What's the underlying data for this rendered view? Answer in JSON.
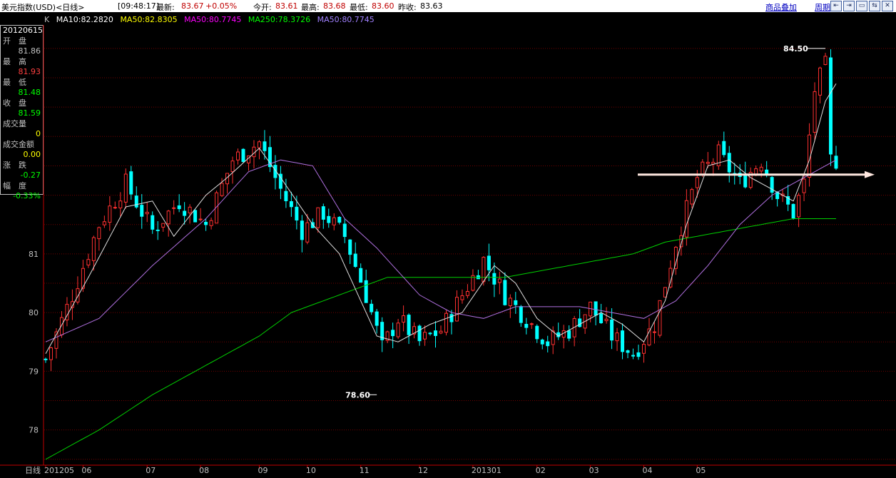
{
  "header": {
    "title": "美元指数(USD)<日线>",
    "time": "[09:48:17]",
    "latest_label": "最新:",
    "latest_value": "83.67",
    "change": "+0.05%",
    "open_label": "今开:",
    "open_value": "83.61",
    "high_label": "最高:",
    "high_value": "83.68",
    "low_label": "最低:",
    "low_value": "83.60",
    "prev_label": "昨收:",
    "prev_value": "83.63",
    "overlay_link": "商品叠加",
    "period_link": "周期"
  },
  "window_buttons": [
    "⇤",
    "⇥",
    "▭",
    "⇆",
    "✕"
  ],
  "ma_legend": {
    "k": "K",
    "items": [
      {
        "text": "MA10:82.2820",
        "color": "#ffffff"
      },
      {
        "text": "MA50:82.8305",
        "color": "#ffff00"
      },
      {
        "text": "MA50:80.7745",
        "color": "#ff00ff"
      },
      {
        "text": "MA250:78.3726",
        "color": "#00ff00"
      },
      {
        "text": "MA50:80.7745",
        "color": "#a080ff"
      }
    ]
  },
  "infobox": {
    "date": "20120615",
    "rows": [
      {
        "label": "开　盘",
        "value": "81.86",
        "color": "#c0c0c0"
      },
      {
        "label": "最　高",
        "value": "81.93",
        "color": "#ff4040"
      },
      {
        "label": "最　低",
        "value": "81.48",
        "color": "#00ff00"
      },
      {
        "label": "收　盘",
        "value": "81.59",
        "color": "#00ff00"
      },
      {
        "label": "成交量",
        "value": "0",
        "color": "#ffff00"
      },
      {
        "label": "成交金额",
        "value": "0.00",
        "color": "#ffff00"
      },
      {
        "label": "涨　跌",
        "value": "-0.27",
        "color": "#00ff00"
      },
      {
        "label": "幅　度",
        "value": "-0.33%",
        "color": "#00ff00"
      }
    ]
  },
  "chart_data": {
    "type": "candlestick",
    "ylim": [
      77.4,
      84.9
    ],
    "y_ticks": [
      "78",
      "79",
      "80",
      "81"
    ],
    "x_ticks": [
      "201205",
      "06",
      "07",
      "08",
      "09",
      "10",
      "11",
      "12",
      "201301",
      "02",
      "03",
      "04",
      "05"
    ],
    "x_axis_prefix": "日线",
    "annotations": [
      {
        "text": "84.50",
        "kind": "high"
      },
      {
        "text": "78.60",
        "kind": "low"
      }
    ],
    "up_color": "#ff3030",
    "down_color": "#00ffff",
    "close_path": [
      [
        0,
        79.2
      ],
      [
        5,
        80.3
      ],
      [
        10,
        81.5
      ],
      [
        15,
        82.2
      ],
      [
        20,
        81.4
      ],
      [
        25,
        81.9
      ],
      [
        30,
        81.5
      ],
      [
        35,
        82.6
      ],
      [
        40,
        82.9
      ],
      [
        44,
        82.1
      ],
      [
        48,
        81.4
      ],
      [
        52,
        81.7
      ],
      [
        56,
        81.3
      ],
      [
        60,
        80.3
      ],
      [
        63,
        79.4
      ],
      [
        66,
        79.9
      ],
      [
        70,
        79.5
      ],
      [
        74,
        79.7
      ],
      [
        78,
        80.3
      ],
      [
        82,
        80.9
      ],
      [
        86,
        80.3
      ],
      [
        90,
        79.9
      ],
      [
        94,
        79.5
      ],
      [
        98,
        79.7
      ],
      [
        102,
        80.1
      ],
      [
        106,
        79.6
      ],
      [
        110,
        79.3
      ],
      [
        114,
        79.8
      ],
      [
        118,
        81.2
      ],
      [
        122,
        82.3
      ],
      [
        126,
        82.7
      ],
      [
        130,
        82.2
      ],
      [
        134,
        82.6
      ],
      [
        137,
        82.0
      ],
      [
        140,
        81.7
      ],
      [
        142,
        82.2
      ],
      [
        144,
        83.8
      ],
      [
        146,
        84.2
      ],
      [
        147,
        82.6
      ]
    ],
    "ma10_path": [
      [
        0,
        79.3
      ],
      [
        8,
        80.6
      ],
      [
        15,
        81.8
      ],
      [
        20,
        81.9
      ],
      [
        24,
        81.3
      ],
      [
        30,
        82.0
      ],
      [
        34,
        82.3
      ],
      [
        40,
        82.8
      ],
      [
        44,
        82.3
      ],
      [
        50,
        81.5
      ],
      [
        55,
        81.0
      ],
      [
        58,
        80.4
      ],
      [
        62,
        79.6
      ],
      [
        66,
        79.5
      ],
      [
        72,
        79.8
      ],
      [
        78,
        80.0
      ],
      [
        84,
        80.8
      ],
      [
        88,
        80.5
      ],
      [
        92,
        79.9
      ],
      [
        96,
        79.6
      ],
      [
        100,
        79.8
      ],
      [
        104,
        80.0
      ],
      [
        108,
        79.8
      ],
      [
        112,
        79.5
      ],
      [
        116,
        80.2
      ],
      [
        120,
        81.5
      ],
      [
        124,
        82.5
      ],
      [
        128,
        82.6
      ],
      [
        132,
        82.3
      ],
      [
        136,
        82.1
      ],
      [
        140,
        81.9
      ],
      [
        143,
        82.6
      ],
      [
        146,
        83.6
      ],
      [
        148,
        83.9
      ]
    ],
    "ma_purple_path": [
      [
        0,
        79.5
      ],
      [
        10,
        79.9
      ],
      [
        20,
        80.8
      ],
      [
        30,
        81.6
      ],
      [
        38,
        82.4
      ],
      [
        44,
        82.6
      ],
      [
        50,
        82.5
      ],
      [
        56,
        81.6
      ],
      [
        62,
        81.1
      ],
      [
        70,
        80.3
      ],
      [
        76,
        80.0
      ],
      [
        82,
        79.9
      ],
      [
        88,
        80.1
      ],
      [
        94,
        80.1
      ],
      [
        100,
        80.1
      ],
      [
        106,
        80.0
      ],
      [
        112,
        79.9
      ],
      [
        118,
        80.2
      ],
      [
        124,
        80.8
      ],
      [
        130,
        81.5
      ],
      [
        136,
        82.0
      ],
      [
        142,
        82.3
      ],
      [
        148,
        82.6
      ]
    ],
    "ma250_path": [
      [
        0,
        77.5
      ],
      [
        10,
        78.0
      ],
      [
        20,
        78.6
      ],
      [
        30,
        79.1
      ],
      [
        40,
        79.6
      ],
      [
        46,
        80.0
      ],
      [
        52,
        80.2
      ],
      [
        58,
        80.4
      ],
      [
        64,
        80.6
      ],
      [
        70,
        80.6
      ],
      [
        78,
        80.6
      ],
      [
        86,
        80.6
      ],
      [
        92,
        80.7
      ],
      [
        98,
        80.8
      ],
      [
        104,
        80.9
      ],
      [
        110,
        81.0
      ],
      [
        116,
        81.2
      ],
      [
        122,
        81.3
      ],
      [
        128,
        81.4
      ],
      [
        134,
        81.5
      ],
      [
        140,
        81.6
      ],
      [
        148,
        81.6
      ]
    ],
    "horizontal_arrow_level": 82.35
  }
}
